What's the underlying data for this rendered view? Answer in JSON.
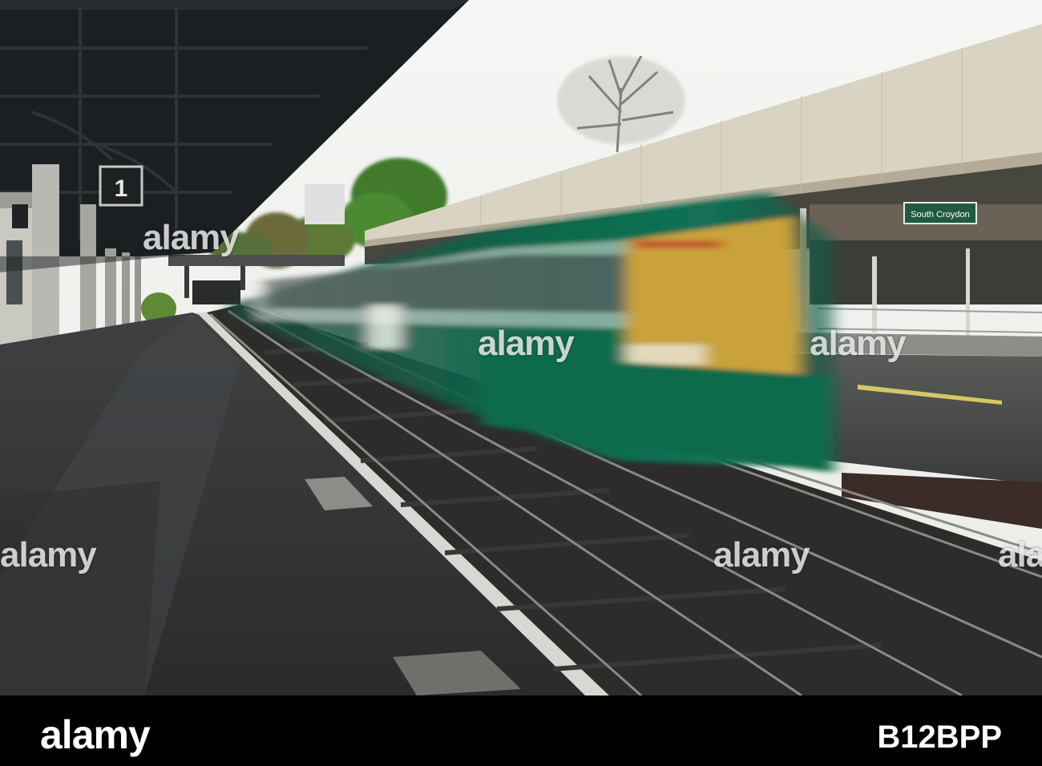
{
  "photo": {
    "platform_number": "1",
    "station_sign": "South Croydon"
  },
  "watermarks": [
    "alamy",
    "alamy",
    "alamy",
    "alamy",
    "alamy",
    "alamy"
  ],
  "footer": {
    "logo": "alamy",
    "image_id": "B12BPP"
  },
  "colors": {
    "train_green": "#0f6a4c",
    "train_yellow": "#c9a23b",
    "canopy_dark": "#1c1f22",
    "sky": "#f4f4f2"
  }
}
